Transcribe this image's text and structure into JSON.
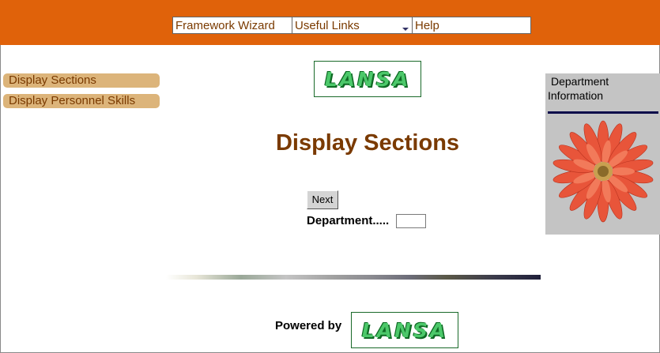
{
  "menu": {
    "items": [
      "Framework Wizard",
      "Useful Links",
      "Help"
    ]
  },
  "sidebar": {
    "items": [
      "Display Sections",
      "Display Personnel Skills"
    ]
  },
  "logo": {
    "text": "LANSA"
  },
  "main": {
    "title": "Display Sections",
    "next_label": "Next",
    "department_label": "Department.....",
    "department_value": ""
  },
  "footer": {
    "powered_by": "Powered by"
  },
  "right_panel": {
    "title_line1": "Department",
    "title_line2": "Information"
  },
  "colors": {
    "header": "#e0620a",
    "link_text": "#7a3a00",
    "nav_button": "#dcb47a",
    "panel": "#c4c4c4",
    "logo_green": "#4cc86a",
    "flower": "#e8553a"
  },
  "icons": {
    "menu_dropdown": "chevron-down-icon",
    "panel_image": "flower-image"
  }
}
